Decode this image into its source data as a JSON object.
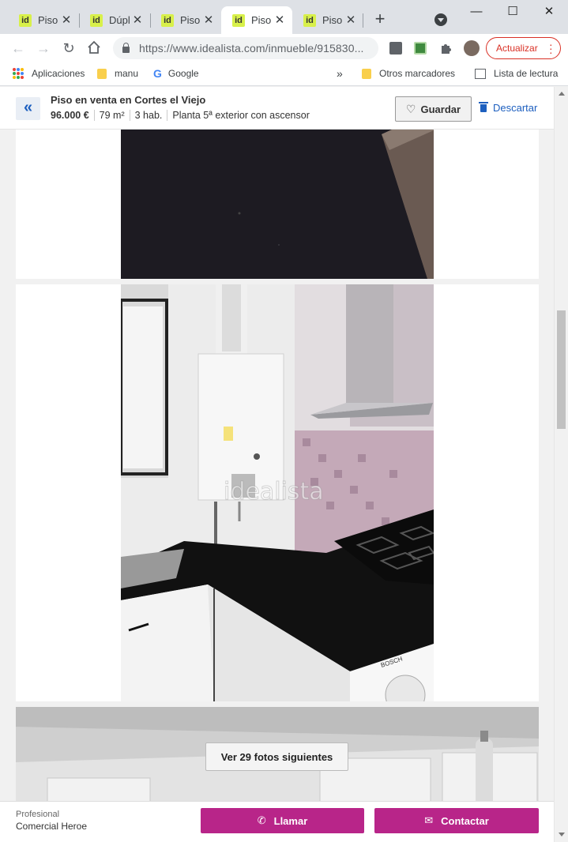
{
  "browser": {
    "tabs": [
      {
        "label": "Piso",
        "active": false
      },
      {
        "label": "Dúpl",
        "active": false
      },
      {
        "label": "Piso",
        "active": false
      },
      {
        "label": "Piso",
        "active": true
      },
      {
        "label": "Piso",
        "active": false
      }
    ],
    "favicon_text": "id",
    "url": "https://www.idealista.com/inmueble/915830...",
    "update_label": "Actualizar"
  },
  "bookmarks": {
    "apps": "Aplicaciones",
    "manu": "manu",
    "google": "Google",
    "more": "»",
    "other": "Otros marcadores",
    "reading_list": "Lista de lectura"
  },
  "listing": {
    "title": "Piso en venta en Cortes el Viejo",
    "price": "96.000 €",
    "area": "79 m²",
    "rooms": "3 hab.",
    "floor": "Planta 5ª exterior con ascensor",
    "save_label": "Guardar",
    "discard_label": "Descartar",
    "watermark": "idealista",
    "more_photos_label": "Ver 29 fotos siguientes"
  },
  "footer": {
    "professional_label": "Profesional",
    "agency": "Comercial Heroe",
    "call_label": "Llamar",
    "contact_label": "Contactar"
  },
  "colors": {
    "accent": "#b82589",
    "link": "#1d5fbf",
    "favicon": "#d8f04a"
  }
}
